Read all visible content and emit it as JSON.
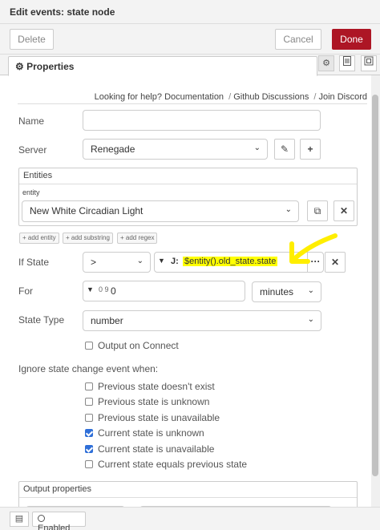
{
  "title": "Edit events: state node",
  "buttons": {
    "delete": "Delete",
    "cancel": "Cancel",
    "done": "Done"
  },
  "tab": {
    "label": "Properties"
  },
  "help": {
    "prefix": "Looking for help?",
    "links": [
      "Documentation",
      "Github Discussions",
      "Join Discord"
    ],
    "separator": "/"
  },
  "form": {
    "name": {
      "label": "Name",
      "value": ""
    },
    "server": {
      "label": "Server",
      "value": "Renegade"
    },
    "entities": {
      "legend": "Entities",
      "entity_label": "entity",
      "entity_value": "New White Circadian Light",
      "add_buttons": [
        "+ add entity",
        "+ add substring",
        "+ add regex"
      ]
    },
    "if_state": {
      "label": "If State",
      "operator": ">",
      "type_icon": "J:",
      "expression": "$entity().old_state.state"
    },
    "for": {
      "label": "For",
      "type_icon": "0 9",
      "value": "0",
      "units": "minutes"
    },
    "state_type": {
      "label": "State Type",
      "value": "number"
    },
    "output_on_connect": {
      "label": "Output on Connect",
      "checked": false
    },
    "ignore": {
      "heading": "Ignore state change event when:",
      "items": [
        {
          "label": "Previous state doesn't exist",
          "checked": false
        },
        {
          "label": "Previous state is unknown",
          "checked": false
        },
        {
          "label": "Previous state is unavailable",
          "checked": false
        },
        {
          "label": "Current state is unknown",
          "checked": true
        },
        {
          "label": "Current state is unavailable",
          "checked": true
        },
        {
          "label": "Current state equals previous state",
          "checked": false
        }
      ]
    },
    "output_properties": {
      "legend": "Output properties"
    }
  },
  "footer": {
    "enabled_label": "Enabled"
  },
  "annotation": {
    "color": "#ffee00"
  }
}
